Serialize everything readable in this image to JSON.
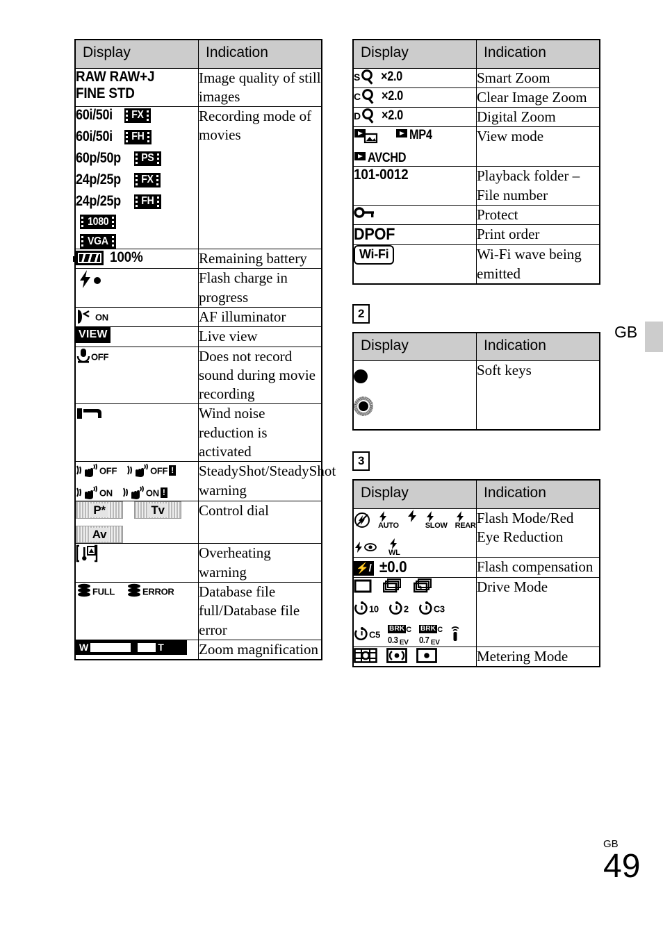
{
  "page": {
    "side_marker": "GB",
    "page_gb": "GB",
    "page_number": "49",
    "header_display": "Display",
    "header_indication": "Indication",
    "accent_gray": "#cccccc"
  },
  "table1": {
    "headers": {
      "display": "Display",
      "indication": "Indication"
    },
    "rows": [
      {
        "display_text": "RAW RAW+J FINE STD",
        "display_lines": [
          "RAW RAW+J",
          "FINE STD"
        ],
        "indication": "Image quality of still images"
      },
      {
        "display_text": "60i/50i FX, 60i/50i FH, 60p/50p PS, 24p/25p FX, 24p/25p FH, 1080, VGA",
        "movie_modes": [
          {
            "rate": "60i/50i",
            "badge": "FX"
          },
          {
            "rate": "60i/50i",
            "badge": "FH"
          },
          {
            "rate": "60p/50p",
            "badge": "PS"
          },
          {
            "rate": "24p/25p",
            "badge": "FX"
          },
          {
            "rate": "24p/25p",
            "badge": "FH"
          },
          {
            "rate": "",
            "badge": "1080"
          },
          {
            "rate": "",
            "badge": "VGA"
          }
        ],
        "indication": "Recording mode of movies"
      },
      {
        "display_text": "100%",
        "battery_value": "100%",
        "indication": "Remaining battery"
      },
      {
        "display_text": "flash-charging-icon",
        "indication": "Flash charge in progress"
      },
      {
        "display_text": "AF illuminator icon ON",
        "af_label": "ON",
        "indication": "AF illuminator"
      },
      {
        "display_text": "VIEW",
        "badge": "VIEW",
        "indication": "Live view"
      },
      {
        "display_text": "microphone OFF",
        "mic_label": "OFF",
        "indication": "Does not record sound during movie recording"
      },
      {
        "display_text": "wind-noise-reduction-icon",
        "indication": "Wind noise reduction is activated"
      },
      {
        "display_text": "SteadyShot OFF / OFF! / ON / ON!",
        "steadyshot": [
          {
            "state": "OFF",
            "warn": false
          },
          {
            "state": "OFF",
            "warn": true
          },
          {
            "state": "ON",
            "warn": false
          },
          {
            "state": "ON",
            "warn": true
          }
        ],
        "indication": "SteadyShot/SteadyShot warning"
      },
      {
        "display_text": "P* Tv Av",
        "dials": [
          "P*",
          "Tv",
          "Av"
        ],
        "indication": "Control dial"
      },
      {
        "display_text": "overheating-warning-icon",
        "indication": "Overheating warning"
      },
      {
        "display_text": "database FULL / ERROR",
        "database": [
          {
            "label": "FULL"
          },
          {
            "label": "ERROR"
          }
        ],
        "indication": "Database file full/Database file error"
      },
      {
        "display_text": "zoom bar W - T",
        "zoom_w": "W",
        "zoom_t": "T",
        "indication": "Zoom magnification"
      }
    ]
  },
  "table2": {
    "headers": {
      "display": "Display",
      "indication": "Indication"
    },
    "rows": [
      {
        "display_text": "S magnifier x2.0",
        "prefix": "S",
        "value": "×2.0",
        "indication": "Smart Zoom"
      },
      {
        "display_text": "C magnifier x2.0",
        "prefix": "C",
        "value": "×2.0",
        "indication": "Clear Image Zoom"
      },
      {
        "display_text": "D magnifier x2.0",
        "prefix": "D",
        "value": "×2.0",
        "indication": "Digital Zoom"
      },
      {
        "display_text": "play still / play MP4 / play AVCHD",
        "view_modes": [
          "",
          "MP4",
          "AVCHD"
        ],
        "indication": "View mode"
      },
      {
        "display_text": "101-0012",
        "value": "101-0012",
        "indication": "Playback folder – File number"
      },
      {
        "display_text": "key-icon",
        "indication": "Protect"
      },
      {
        "display_text": "DPOF",
        "value": "DPOF",
        "indication": "Print order"
      },
      {
        "display_text": "Wi-Fi",
        "badge": "Wi-Fi",
        "indication": "Wi-Fi wave being emitted"
      }
    ]
  },
  "section2": {
    "number": "2",
    "headers": {
      "display": "Display",
      "indication": "Indication"
    },
    "rows": [
      {
        "display_text": "filled dot / ringed dot",
        "indication": "Soft keys"
      }
    ]
  },
  "section3": {
    "number": "3",
    "headers": {
      "display": "Display",
      "indication": "Indication"
    },
    "rows": [
      {
        "display_text": "flash off, AUTO, fill, SLOW, REAR, red-eye, WL",
        "flash_modes": [
          "",
          "AUTO",
          "",
          "SLOW",
          "REAR",
          "",
          "WL"
        ],
        "indication": "Flash Mode/Red Eye Reduction"
      },
      {
        "display_text": "flash compensation ±0.0",
        "value": "±0.0",
        "indication": "Flash compensation"
      },
      {
        "display_text": "single, continuous, speed priority, self-timer 10, 2, C3, C5, BRK C 0.3EV, BRK C 0.7EV, remote",
        "drive_modes": [
          "single",
          "continuous",
          "speed-priority",
          "selftimer-10",
          "selftimer-2",
          "selftimer-C3",
          "selftimer-C5",
          "bracket-C-0.3EV",
          "bracket-C-0.7EV",
          "remote"
        ],
        "timer_labels": [
          "10",
          "2",
          "C3",
          "C5"
        ],
        "bracket_labels": [
          {
            "brk": "BRK",
            "c": "C",
            "ev": "0.3",
            "evunit": "EV"
          },
          {
            "brk": "BRK",
            "c": "C",
            "ev": "0.7",
            "evunit": "EV"
          }
        ],
        "indication": "Drive Mode"
      },
      {
        "display_text": "multi / center / spot metering",
        "indication": "Metering Mode"
      }
    ]
  }
}
